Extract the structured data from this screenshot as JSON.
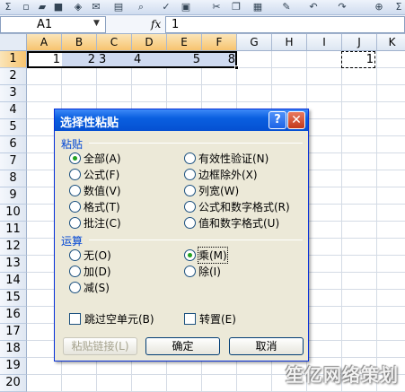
{
  "formula_bar": {
    "name_box": "A1",
    "fx": "fx",
    "formula": "1"
  },
  "columns": [
    "A",
    "B",
    "C",
    "D",
    "E",
    "F",
    "G",
    "H",
    "I",
    "J",
    "K"
  ],
  "rows": [
    "1",
    "2",
    "3",
    "4",
    "5",
    "6",
    "7",
    "8",
    "9",
    "10",
    "11",
    "12",
    "13",
    "14",
    "15",
    "16",
    "17",
    "18",
    "19",
    "20"
  ],
  "cells": {
    "A1": "1",
    "B1": "2",
    "C1": "3",
    "D1": "4",
    "E1": "5",
    "F1": "8",
    "J1": "1"
  },
  "dialog": {
    "title": "选择性粘贴",
    "help": "?",
    "close": "✕",
    "paste_group": "粘贴",
    "paste_options": [
      {
        "label": "全部(A)",
        "selected": true
      },
      {
        "label": "公式(F)",
        "selected": false
      },
      {
        "label": "数值(V)",
        "selected": false
      },
      {
        "label": "格式(T)",
        "selected": false
      },
      {
        "label": "批注(C)",
        "selected": false
      },
      {
        "label": "有效性验证(N)",
        "selected": false
      },
      {
        "label": "边框除外(X)",
        "selected": false
      },
      {
        "label": "列宽(W)",
        "selected": false
      },
      {
        "label": "公式和数字格式(R)",
        "selected": false
      },
      {
        "label": "值和数字格式(U)",
        "selected": false
      }
    ],
    "operation_group": "运算",
    "operation_options": [
      {
        "label": "无(O)",
        "selected": false
      },
      {
        "label": "加(D)",
        "selected": false
      },
      {
        "label": "减(S)",
        "selected": false
      },
      {
        "label": "乘(M)",
        "selected": true
      },
      {
        "label": "除(I)",
        "selected": false
      }
    ],
    "skip_blanks": "跳过空单元(B)",
    "transpose": "转置(E)",
    "paste_link": "粘贴链接(L)",
    "ok": "确定",
    "cancel": "取消"
  },
  "watermark": "笙亿网络策划"
}
